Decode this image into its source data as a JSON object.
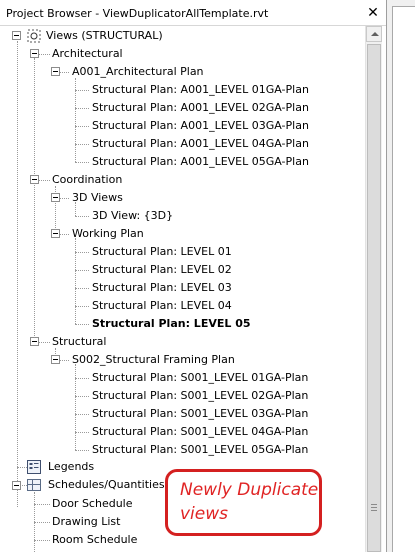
{
  "window": {
    "title": "Project Browser - ViewDuplicatorAllTemplate.rvt",
    "close_glyph": "✕"
  },
  "tree": {
    "root": "Views (STRUCTURAL)",
    "architectural": {
      "label": "Architectural",
      "sheet": "A001_Architectural Plan",
      "views": [
        "Structural Plan: A001_LEVEL 01GA-Plan",
        "Structural Plan: A001_LEVEL 02GA-Plan",
        "Structural Plan: A001_LEVEL 03GA-Plan",
        "Structural Plan: A001_LEVEL 04GA-Plan",
        "Structural Plan: A001_LEVEL 05GA-Plan"
      ]
    },
    "coordination": {
      "label": "Coordination",
      "views_3d_label": "3D Views",
      "view_3d": "3D View: {3D}",
      "working_plan_label": "Working Plan",
      "working_views": [
        "Structural Plan: LEVEL 01",
        "Structural Plan: LEVEL 02",
        "Structural Plan: LEVEL 03",
        "Structural Plan: LEVEL 04",
        "Structural Plan: LEVEL 05"
      ]
    },
    "structural": {
      "label": "Structural",
      "sheet": "S002_Structural Framing Plan",
      "views": [
        "Structural Plan: S001_LEVEL 01GA-Plan",
        "Structural Plan: S001_LEVEL 02GA-Plan",
        "Structural Plan: S001_LEVEL 03GA-Plan",
        "Structural Plan: S001_LEVEL 04GA-Plan",
        "Structural Plan: S001_LEVEL 05GA-Plan"
      ]
    },
    "legends": "Legends",
    "schedules": {
      "label": "Schedules/Quantities",
      "items": [
        "Door Schedule",
        "Drawing List",
        "Room Schedule"
      ]
    }
  },
  "annotation": {
    "text": "Newly Duplicate\nviews",
    "color": "#e02424"
  },
  "colors": {
    "tree_lines": "#9a9a9a",
    "annotation_border": "#d42020"
  }
}
